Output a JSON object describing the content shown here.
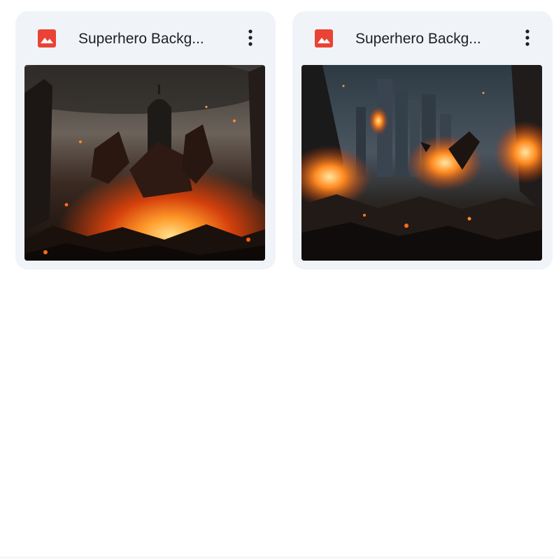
{
  "files": [
    {
      "title": "Superhero Backg...",
      "icon": "image-icon",
      "icon_color": "#ea4335",
      "thumbnail": "burning-city-explosion"
    },
    {
      "title": "Superhero Backg...",
      "icon": "image-icon",
      "icon_color": "#ea4335",
      "thumbnail": "ruined-skyline-fire"
    }
  ],
  "more_icon": "more-vert-icon"
}
